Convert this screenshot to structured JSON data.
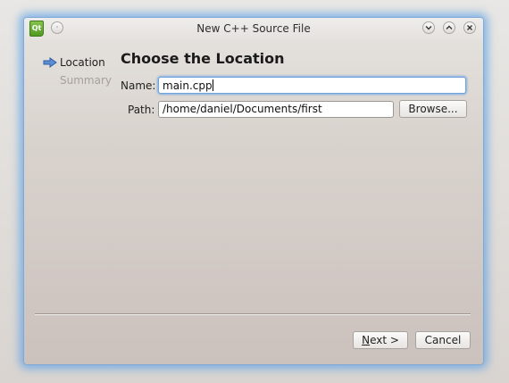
{
  "window": {
    "title": "New C++ Source File",
    "app_icon_glyph": "Qt",
    "on_all_desktops_glyph": "·",
    "minimize_glyph": "⌄",
    "maximize_glyph": "⌃",
    "close_glyph": "✕",
    "border_color": "#7fa9d6",
    "glow_color": "#5ca0e6"
  },
  "wizard": {
    "steps": [
      {
        "label": "Location",
        "active": true,
        "icon": "arrow-right-icon"
      },
      {
        "label": "Summary",
        "active": false
      }
    ],
    "page_title": "Choose the Location"
  },
  "form": {
    "name_label": "Name:",
    "name_value": "main.cpp",
    "path_label": "Path:",
    "path_value": "/home/daniel/Documents/first",
    "browse_label": "Browse..."
  },
  "footer": {
    "next_label": "Next >",
    "next_mnemonic": "N",
    "next_rest": "ext >",
    "cancel_label": "Cancel"
  },
  "colors": {
    "focus_ring": "#6ea3e0",
    "arrow_icon": "#2f5fa8"
  }
}
